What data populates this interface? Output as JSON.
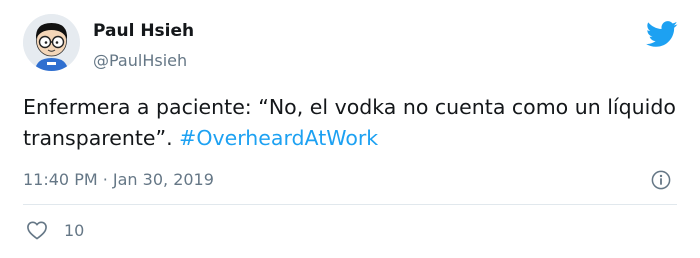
{
  "user": {
    "display_name": "Paul Hsieh",
    "handle": "@PaulHsieh",
    "avatar_icon": "cartoon-avatar-with-glasses"
  },
  "tweet": {
    "text_plain": "Enfermera a paciente: “No, el vodka no cuenta como un líquido transparente”. ",
    "hashtag": "#OverheardAtWork"
  },
  "meta": {
    "timestamp": "11:40 PM · Jan 30, 2019"
  },
  "actions": {
    "like_count": "10",
    "like_icon": "heart-icon",
    "info_icon": "info-icon"
  },
  "brand": {
    "logo_icon": "twitter-bird-icon",
    "accent_color": "#1da1f2"
  }
}
